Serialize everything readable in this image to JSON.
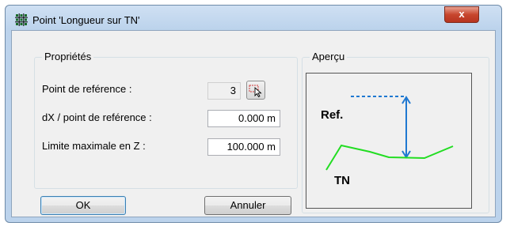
{
  "window": {
    "title": "Point 'Longueur sur TN'",
    "close_glyph": "x"
  },
  "properties": {
    "label": "Propriétés",
    "ref_point_label": "Point de reférence :",
    "ref_point_value": "3",
    "dx_label": "dX / point de reférence :",
    "dx_value": "0.000 m",
    "zmax_label": "Limite maximale en Z :",
    "zmax_value": "100.000 m"
  },
  "preview": {
    "label": "Aperçu",
    "ref_text": "Ref.",
    "tn_text": "TN"
  },
  "buttons": {
    "ok": "OK",
    "cancel": "Annuler"
  },
  "icons": {
    "app": "grid-icon",
    "pick": "pick-point-icon"
  },
  "colors": {
    "terrain": "#22dd22",
    "reference": "#1f78d1",
    "close": "#c7462d"
  }
}
